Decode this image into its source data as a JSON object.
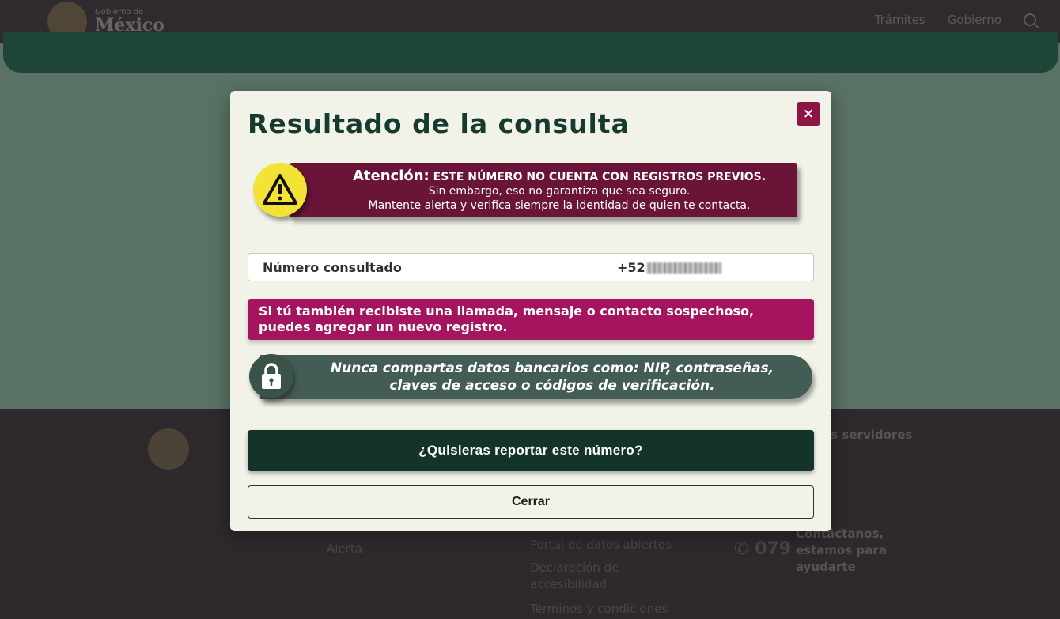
{
  "header": {
    "brand_small": "Gobierno de",
    "brand_big": "México",
    "nav": [
      "Trámites",
      "Gobierno"
    ]
  },
  "footer": {
    "servidores": "os servidores",
    "links_col1": [
      "Alerta"
    ],
    "links_col2": [
      "Portal de datos abiertos",
      "Declaración de accesibilidad",
      "Términos y condiciones"
    ],
    "phone": "079",
    "phone_text": "Contáctanos, estamos para ayudarte"
  },
  "modal": {
    "title": "Resultado de la consulta",
    "close_symbol": "×",
    "alert": {
      "lead": "Atención:",
      "line1": "ESTE NÚMERO NO CUENTA CON REGISTROS PREVIOS.",
      "line2": "Sin embargo, eso no garantiza que sea seguro.",
      "line3": "Mantente alerta y verifica siempre la identidad de quien te contacta."
    },
    "number": {
      "label": "Número consultado",
      "prefix": "+52"
    },
    "report_info": "Si tú también recibiste una llamada, mensaje o contacto sospechoso, puedes agregar un nuevo registro.",
    "security_tip": {
      "line1": "Nunca compartas datos bancarios como: NIP, contraseñas,",
      "line2": "claves de acceso o códigos de verificación."
    },
    "report_button": "¿Quisieras reportar este número?",
    "close_button": "Cerrar"
  },
  "colors": {
    "accent_wine": "#8c1545",
    "alert_band": "#6a1538",
    "report_info": "#a5145e",
    "dark_green": "#14332a",
    "warning_yellow": "#f2e334"
  }
}
